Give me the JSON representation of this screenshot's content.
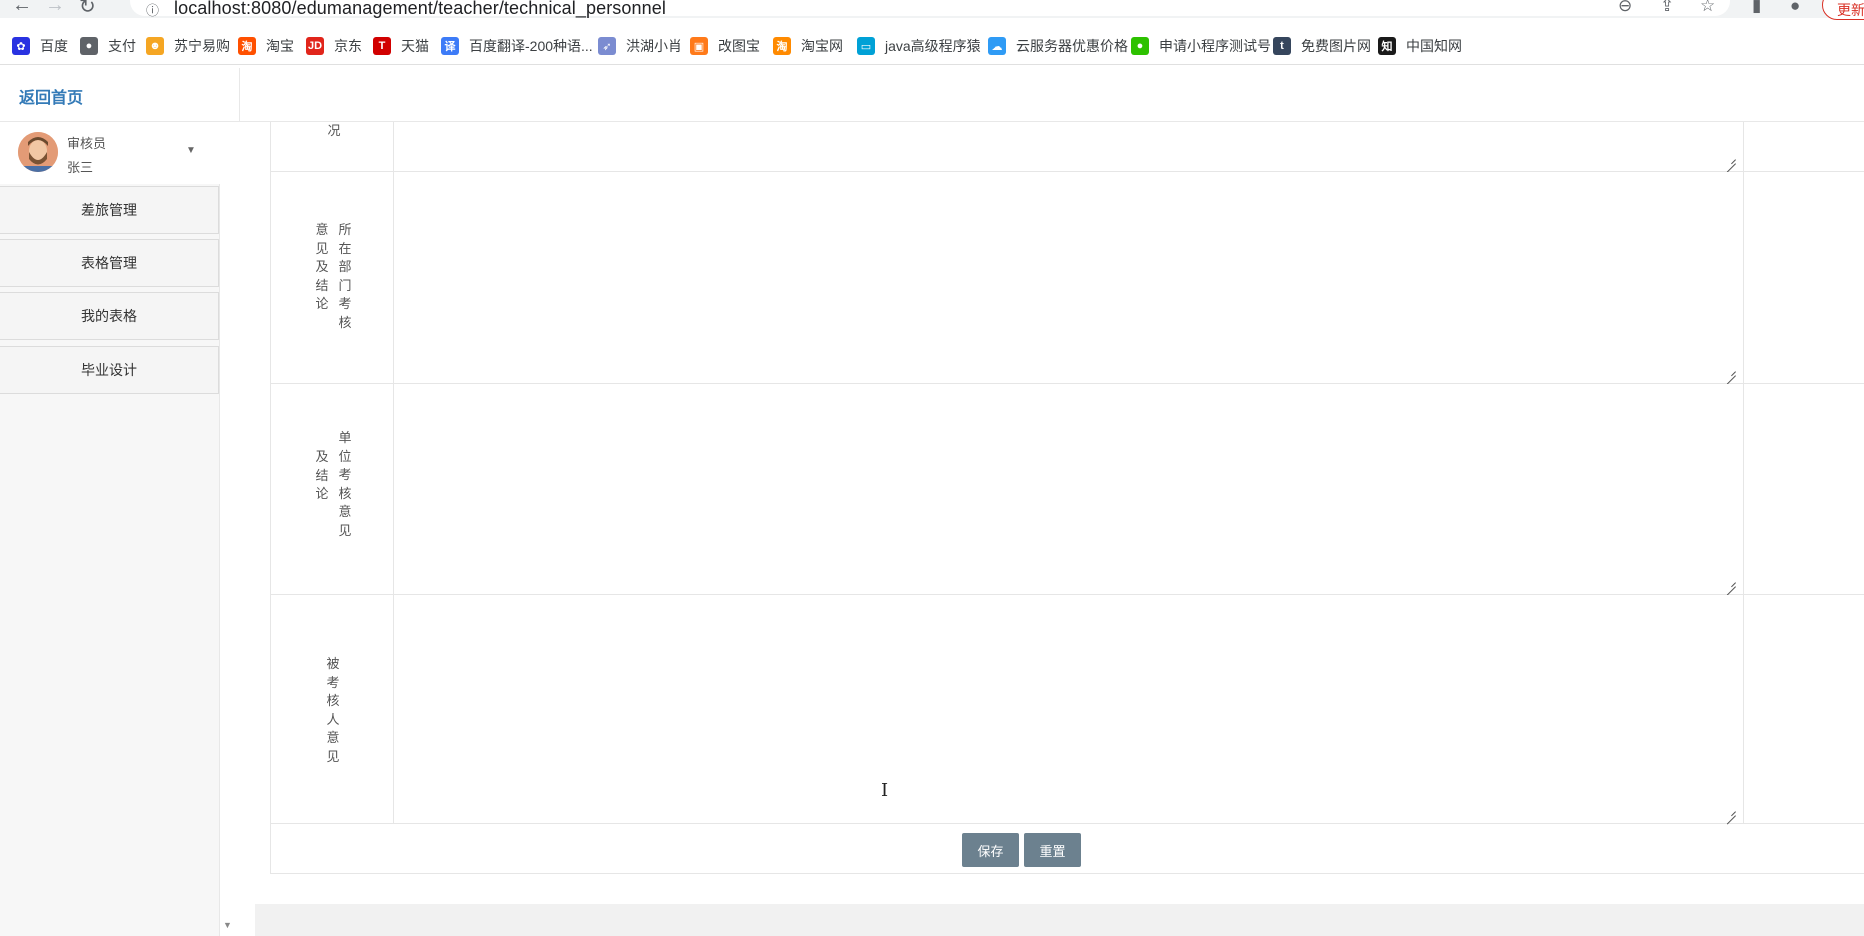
{
  "browser": {
    "url": "localhost:8080/edumanagement/teacher/technical_personnel",
    "update_label": "更新",
    "bookmarks": [
      {
        "label": "百度",
        "icon": "baidu-icon",
        "color": "#2932e1",
        "glyph": "✿"
      },
      {
        "label": "支付",
        "icon": "globe-icon",
        "color": "#5f6368",
        "glyph": "●"
      },
      {
        "label": "苏宁易购",
        "icon": "suning-icon",
        "color": "#f5a623",
        "glyph": "☻"
      },
      {
        "label": "淘宝",
        "icon": "taobao-icon",
        "color": "#ff5000",
        "glyph": "淘"
      },
      {
        "label": "京东",
        "icon": "jd-icon",
        "color": "#e1251b",
        "glyph": "JD"
      },
      {
        "label": "天猫",
        "icon": "tmall-icon",
        "color": "#d10000",
        "glyph": "T"
      },
      {
        "label": "百度翻译-200种语...",
        "icon": "translate-icon",
        "color": "#3d7bf7",
        "glyph": "译"
      },
      {
        "label": "洪湖小肖",
        "icon": "rocket-icon",
        "color": "#7b8cd1",
        "glyph": "➶"
      },
      {
        "label": "改图宝",
        "icon": "gaitubao-icon",
        "color": "#ff7a1a",
        "glyph": "▣"
      },
      {
        "label": "淘宝网",
        "icon": "taobao-icon",
        "color": "#ff8a00",
        "glyph": "淘"
      },
      {
        "label": "java高级程序猿",
        "icon": "bilibili-icon",
        "color": "#00a1d6",
        "glyph": "▭"
      },
      {
        "label": "云服务器优惠价格",
        "icon": "cloud-icon",
        "color": "#2f9bf5",
        "glyph": "☁"
      },
      {
        "label": "申请小程序测试号",
        "icon": "wechat-icon",
        "color": "#2dc100",
        "glyph": "●"
      },
      {
        "label": "免费图片网",
        "icon": "tumblr-icon",
        "color": "#36465d",
        "glyph": "t"
      },
      {
        "label": "中国知网",
        "icon": "cnki-icon",
        "color": "#1a1a1a",
        "glyph": "知"
      }
    ]
  },
  "app": {
    "home_link": "返回首页",
    "accent_color": "#337ab7"
  },
  "user": {
    "role": "审核员",
    "name": "张三"
  },
  "sidebar": {
    "items": [
      {
        "label": "差旅管理"
      },
      {
        "label": "表格管理"
      },
      {
        "label": "我的表格"
      },
      {
        "label": "毕业设计"
      }
    ]
  },
  "form": {
    "rows": [
      {
        "id": "situation",
        "col_left": "",
        "col_right": "况"
      },
      {
        "id": "dept-review",
        "col_left": "意见及结论",
        "col_right": "所在部门考核"
      },
      {
        "id": "unit-review",
        "col_left": "及结论",
        "col_right": "单位考核意见"
      },
      {
        "id": "appraisee-opinion",
        "col_left": "",
        "col_right": "被考核人意见"
      }
    ],
    "save_label": "保存",
    "reset_label": "重置",
    "button_color": "#6c818f"
  }
}
